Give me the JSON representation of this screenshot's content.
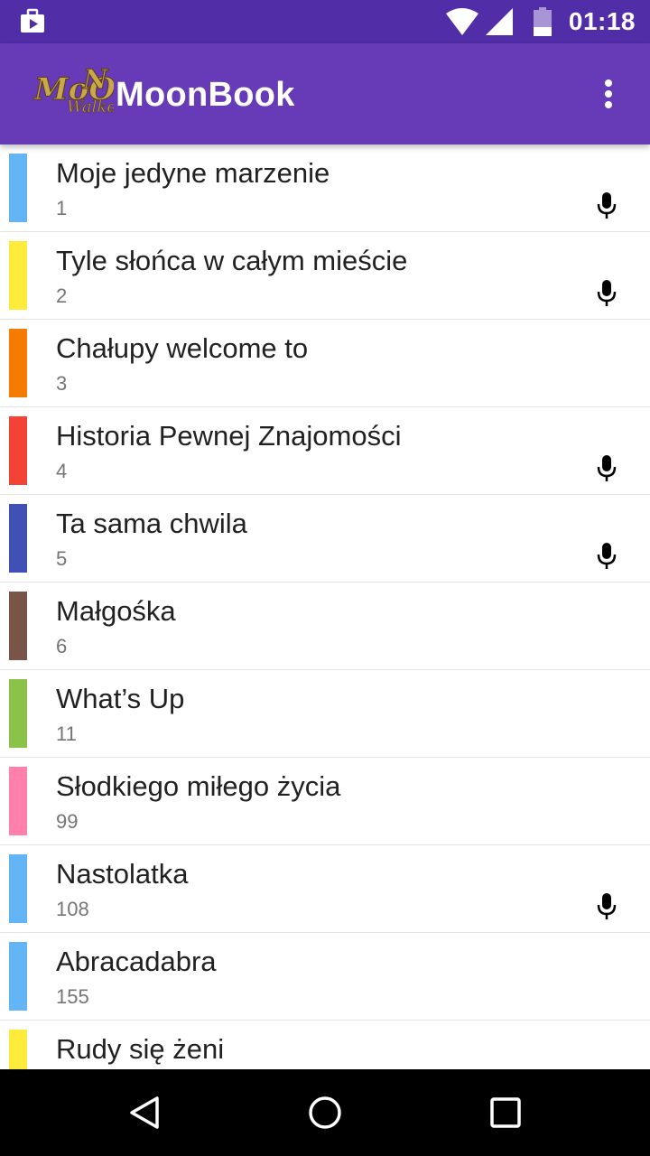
{
  "status_bar": {
    "time": "01:18",
    "icons": [
      "notification-bag-icon",
      "wifi-icon",
      "signal-icon",
      "battery-icon"
    ]
  },
  "app_bar": {
    "logo_text": "MoonWalker",
    "title": "MoonBook",
    "menu_icon": "more-vert-icon"
  },
  "colors": {
    "status_bar": "#512DA8",
    "app_bar": "#673AB7"
  },
  "songs": [
    {
      "title": "Moje jedyne marzenie",
      "number": "1",
      "color": "#64B5F6",
      "has_audio": true
    },
    {
      "title": "Tyle słońca w całym mieście",
      "number": "2",
      "color": "#FFEB3B",
      "has_audio": true
    },
    {
      "title": "Chałupy welcome to",
      "number": "3",
      "color": "#F57C00",
      "has_audio": false
    },
    {
      "title": "Historia Pewnej Znajomości",
      "number": "4",
      "color": "#F44336",
      "has_audio": true
    },
    {
      "title": "Ta sama chwila",
      "number": "5",
      "color": "#3F51B5",
      "has_audio": true
    },
    {
      "title": "Małgośka",
      "number": "6",
      "color": "#795548",
      "has_audio": false
    },
    {
      "title": "What’s Up",
      "number": "11",
      "color": "#8BC34A",
      "has_audio": false
    },
    {
      "title": "Słodkiego miłego życia",
      "number": "99",
      "color": "#FF80AB",
      "has_audio": false
    },
    {
      "title": "Nastolatka",
      "number": "108",
      "color": "#64B5F6",
      "has_audio": true
    },
    {
      "title": "Abracadabra",
      "number": "155",
      "color": "#64B5F6",
      "has_audio": false
    },
    {
      "title": "Rudy się żeni",
      "number": "",
      "color": "#FFEB3B",
      "has_audio": false
    }
  ],
  "nav_bar": {
    "buttons": [
      "back-icon",
      "home-icon",
      "recent-apps-icon"
    ]
  }
}
